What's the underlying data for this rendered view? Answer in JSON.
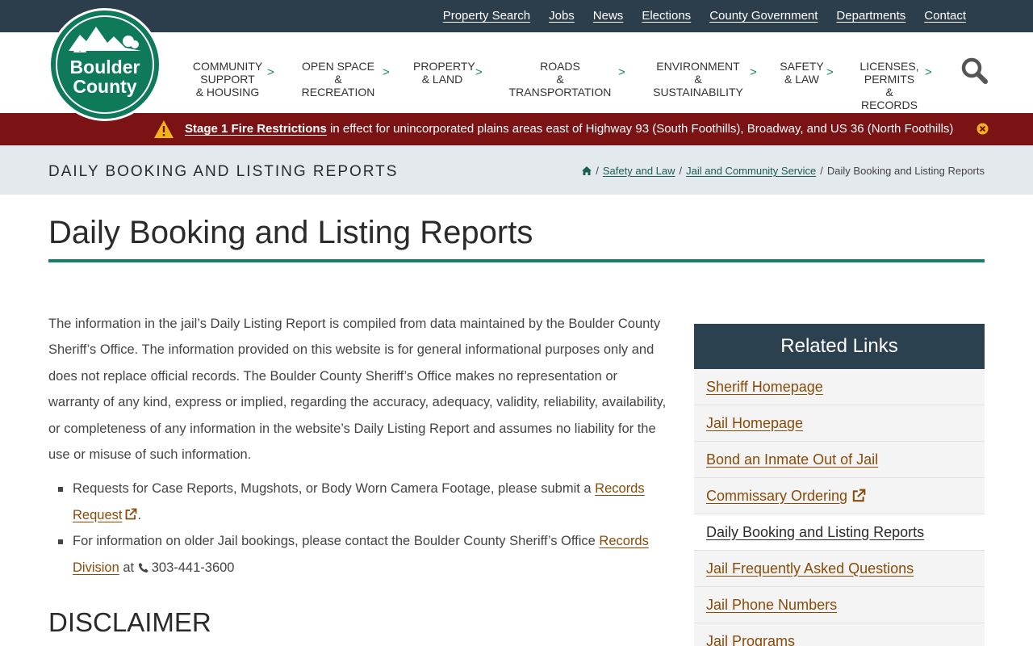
{
  "topbar": {
    "links": [
      "Property Search",
      "Jobs",
      "News",
      "Elections",
      "County Government",
      "Departments",
      "Contact"
    ]
  },
  "logo": {
    "line1": "Boulder",
    "line2": "County"
  },
  "mainnav": {
    "items": [
      {
        "line1": "Community",
        "line2": "Support",
        "line3": "& Housing"
      },
      {
        "line1": "Open Space",
        "line2": "& Recreation",
        "line3": ""
      },
      {
        "line1": "Property",
        "line2": "& Land",
        "line3": ""
      },
      {
        "line1": "Roads",
        "line2": "& Transportation",
        "line3": ""
      },
      {
        "line1": "Environment",
        "line2": "& Sustainability",
        "line3": ""
      },
      {
        "line1": "Safety",
        "line2": "& Law",
        "line3": ""
      },
      {
        "line1": "Licenses,",
        "line2": "Permits",
        "line3": "& Records"
      }
    ],
    "chevron": ">",
    "search_icon": "search-icon"
  },
  "alert": {
    "link": "Stage 1 Fire Restrictions",
    "text": " in effect for unincorporated plains areas east of Highway 93 (South Foothills), Broadway, and US 36 (North Foothills)",
    "icon": "warning-icon",
    "color": "#7b1214"
  },
  "titlebar": {
    "title": "Daily Booking and Listing Reports",
    "breadcrumb": {
      "home_icon": "home-icon",
      "items": [
        "Safety and Law",
        "Jail and Community Service"
      ],
      "current": "Daily Booking and Listing Reports",
      "sep": "/"
    }
  },
  "main": {
    "heading": "Daily Booking and Listing Reports",
    "intro": "The information in the jail’s Daily Listing Report is compiled from data maintained by the Boulder County Sheriff’s Office. The information provided on this website is for general informational purposes only and does not replace official records. The Boulder County Sheriff’s Office makes no representation or warranty of any kind, express or implied, regarding the accuracy, adequacy, validity, reliability, availability, or completeness of any information in the website’s Daily Listing Report and assumes no liability for the use or misuse of such information.",
    "bullets": [
      {
        "before": "Requests for Case Reports, Mugshots, or Body Worn Camera Footage, please submit a ",
        "link": "Records Request",
        "after": "."
      },
      {
        "before": "For information on older Jail bookings, please contact the Boulder County Sheriff’s Office ",
        "link": "Records Division",
        "after": " at ",
        "phone": "303-441-3600"
      }
    ],
    "disclaimer_heading": "DISCLAIMER"
  },
  "sidebar": {
    "title": "Related Links",
    "links": [
      {
        "label": "Sheriff Homepage",
        "external": false,
        "current": false
      },
      {
        "label": "Jail Homepage",
        "external": false,
        "current": false
      },
      {
        "label": "Bond an Inmate Out of Jail",
        "external": false,
        "current": false
      },
      {
        "label": "Commissary Ordering",
        "external": true,
        "current": false
      },
      {
        "label": "Daily Booking and Listing Reports",
        "external": false,
        "current": true
      },
      {
        "label": "Jail Frequently Asked Questions",
        "external": false,
        "current": false
      },
      {
        "label": "Jail Phone Numbers",
        "external": false,
        "current": false
      },
      {
        "label": "Jail Programs",
        "external": false,
        "current": false
      }
    ]
  },
  "colors": {
    "topbar": "#2c3e4c",
    "brand_green": "#0e7a5a",
    "link": "#8a4b08",
    "sidebar_head": "#2c4150"
  }
}
